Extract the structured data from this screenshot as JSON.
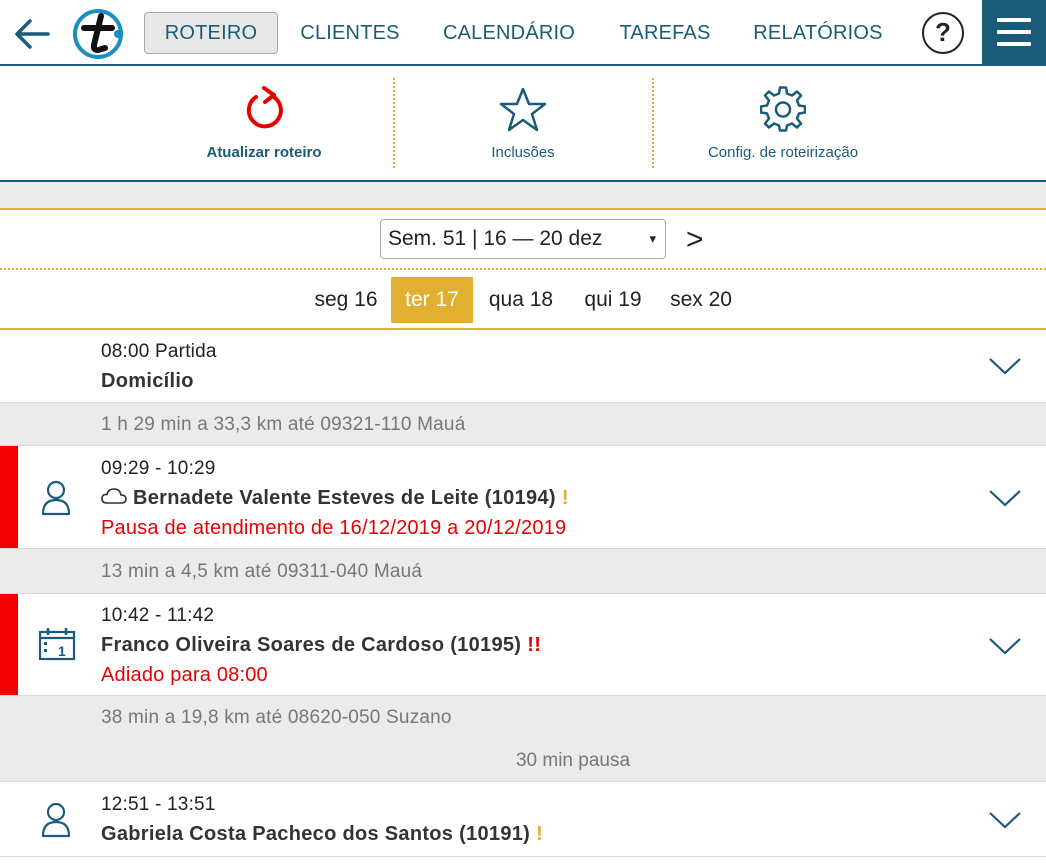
{
  "nav": {
    "tabs": [
      {
        "label": "ROTEIRO",
        "active": true
      },
      {
        "label": "CLIENTES",
        "active": false
      },
      {
        "label": "CALENDÁRIO",
        "active": false
      },
      {
        "label": "TAREFAS",
        "active": false
      },
      {
        "label": "RELATÓRIOS",
        "active": false
      }
    ],
    "help_label": "?",
    "icons": {
      "back": "arrow-left-icon",
      "logo": "t-logo",
      "menu": "hamburger-icon"
    }
  },
  "toolbar": {
    "refresh_label": "Atualizar roteiro",
    "inclusions_label": "Inclusões",
    "config_label": "Config. de roteirização"
  },
  "week": {
    "selected": "Sem. 51 | 16 — 20 dez",
    "caret": "▾",
    "next": ">"
  },
  "days": [
    {
      "label": "seg 16",
      "active": false
    },
    {
      "label": "ter 17",
      "active": true
    },
    {
      "label": "qua 18",
      "active": false
    },
    {
      "label": "qui 19",
      "active": false
    },
    {
      "label": "sex 20",
      "active": false
    }
  ],
  "route": {
    "start": {
      "time": "08:00 Partida",
      "name": "Domicílio"
    },
    "travel1": "1 h 29 min a 33,3 km até 09321-110 Mauá",
    "stop1": {
      "time": "09:29 - 10:29",
      "name": "Bernadete Valente Esteves de Leite (10194)",
      "priority": "!",
      "alert": "Pausa de atendimento de 16/12/2019 a 20/12/2019",
      "icon": "person-icon",
      "weather_icon": "cloud-icon"
    },
    "travel2": "13 min a 4,5 km até 09311-040 Mauá",
    "stop2": {
      "time": "10:42 - 11:42",
      "name": "Franco Oliveira Soares de Cardoso (10195)",
      "priority": "!!",
      "alert": "Adiado para 08:00",
      "icon": "calendar-icon",
      "calendar_day": "1"
    },
    "travel3": "38 min a 19,8 km até 08620-050 Suzano",
    "pause": "30 min pausa",
    "stop3": {
      "time": "12:51 - 13:51",
      "name": "Gabriela Costa Pacheco dos Santos (10191)",
      "priority": "!",
      "icon": "person-icon"
    }
  },
  "colors": {
    "brand": "#1a5b7a",
    "accent": "#e2b030",
    "alert": "#e60000",
    "flag": "#f20000"
  }
}
